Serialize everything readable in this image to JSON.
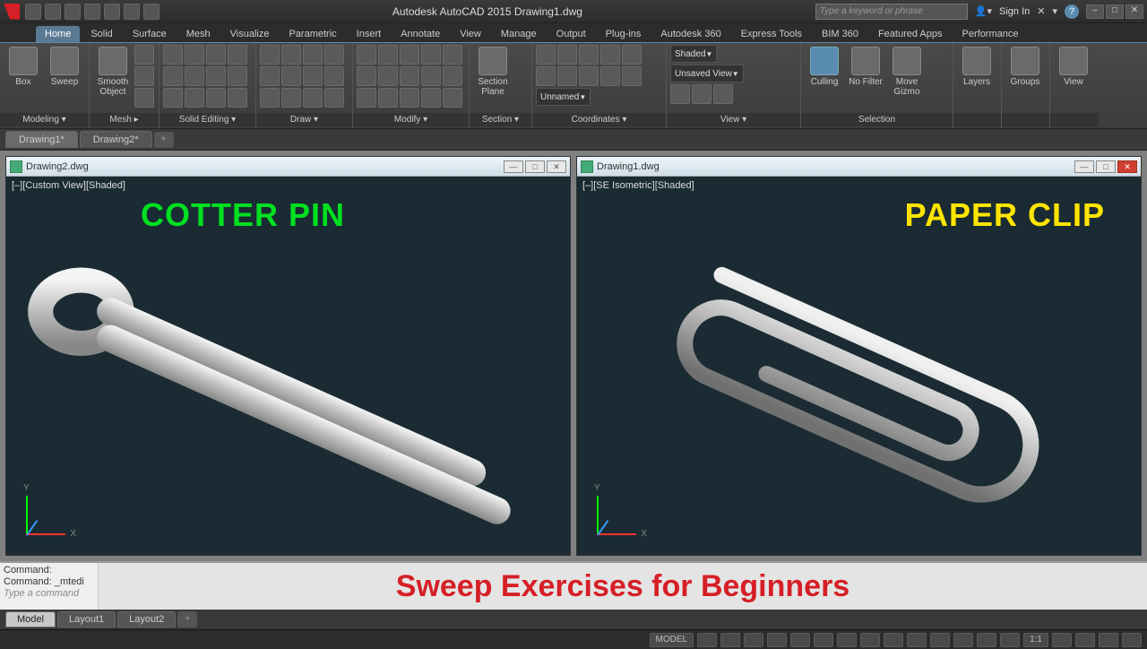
{
  "titlebar": {
    "app_title": "Autodesk AutoCAD 2015   Drawing1.dwg",
    "search_placeholder": "Type a keyword or phrase",
    "sign_in": "Sign In",
    "help_icon": "?"
  },
  "ribbon_tabs": [
    "Home",
    "Solid",
    "Surface",
    "Mesh",
    "Visualize",
    "Parametric",
    "Insert",
    "Annotate",
    "View",
    "Manage",
    "Output",
    "Plug-ins",
    "Autodesk 360",
    "Express Tools",
    "BIM 360",
    "Featured Apps",
    "Performance"
  ],
  "ribbon_active": "Home",
  "panels": {
    "modeling": {
      "label": "Modeling ▾",
      "box": "Box",
      "sweep": "Sweep"
    },
    "mesh": {
      "label": "Mesh ▸",
      "smooth": "Smooth\nObject"
    },
    "solid_editing": {
      "label": "Solid Editing ▾"
    },
    "draw": {
      "label": "Draw ▾"
    },
    "modify": {
      "label": "Modify ▾"
    },
    "section": {
      "label": "Section ▾",
      "plane": "Section\nPlane"
    },
    "coordinates": {
      "label": "Coordinates ▾",
      "unnamed": "Unnamed"
    },
    "view": {
      "label": "View ▾",
      "shaded": "Shaded",
      "unsaved": "Unsaved View"
    },
    "selection": {
      "label": "Selection",
      "culling": "Culling",
      "nofilter": "No Filter",
      "gizmo": "Move\nGizmo"
    },
    "layers": {
      "label": "Layers"
    },
    "groups": {
      "label": "Groups"
    },
    "viewpanel": {
      "label": "View"
    }
  },
  "file_tabs": [
    "Drawing1*",
    "Drawing2*"
  ],
  "viewport_left": {
    "title": "Drawing2.dwg",
    "corner": "[–][Custom View][Shaded]",
    "overlay": "COTTER PIN"
  },
  "viewport_right": {
    "title": "Drawing1.dwg",
    "corner": "[–][SE Isometric][Shaded]",
    "overlay": "PAPER CLIP"
  },
  "cmd": {
    "l1": "Command:",
    "l2": "Command: _mtedi",
    "input_placeholder": "Type a command"
  },
  "banner": "Sweep Exercises for Beginners",
  "model_tabs": [
    "Model",
    "Layout1",
    "Layout2"
  ],
  "status": {
    "model": "MODEL",
    "scale": "1:1"
  }
}
